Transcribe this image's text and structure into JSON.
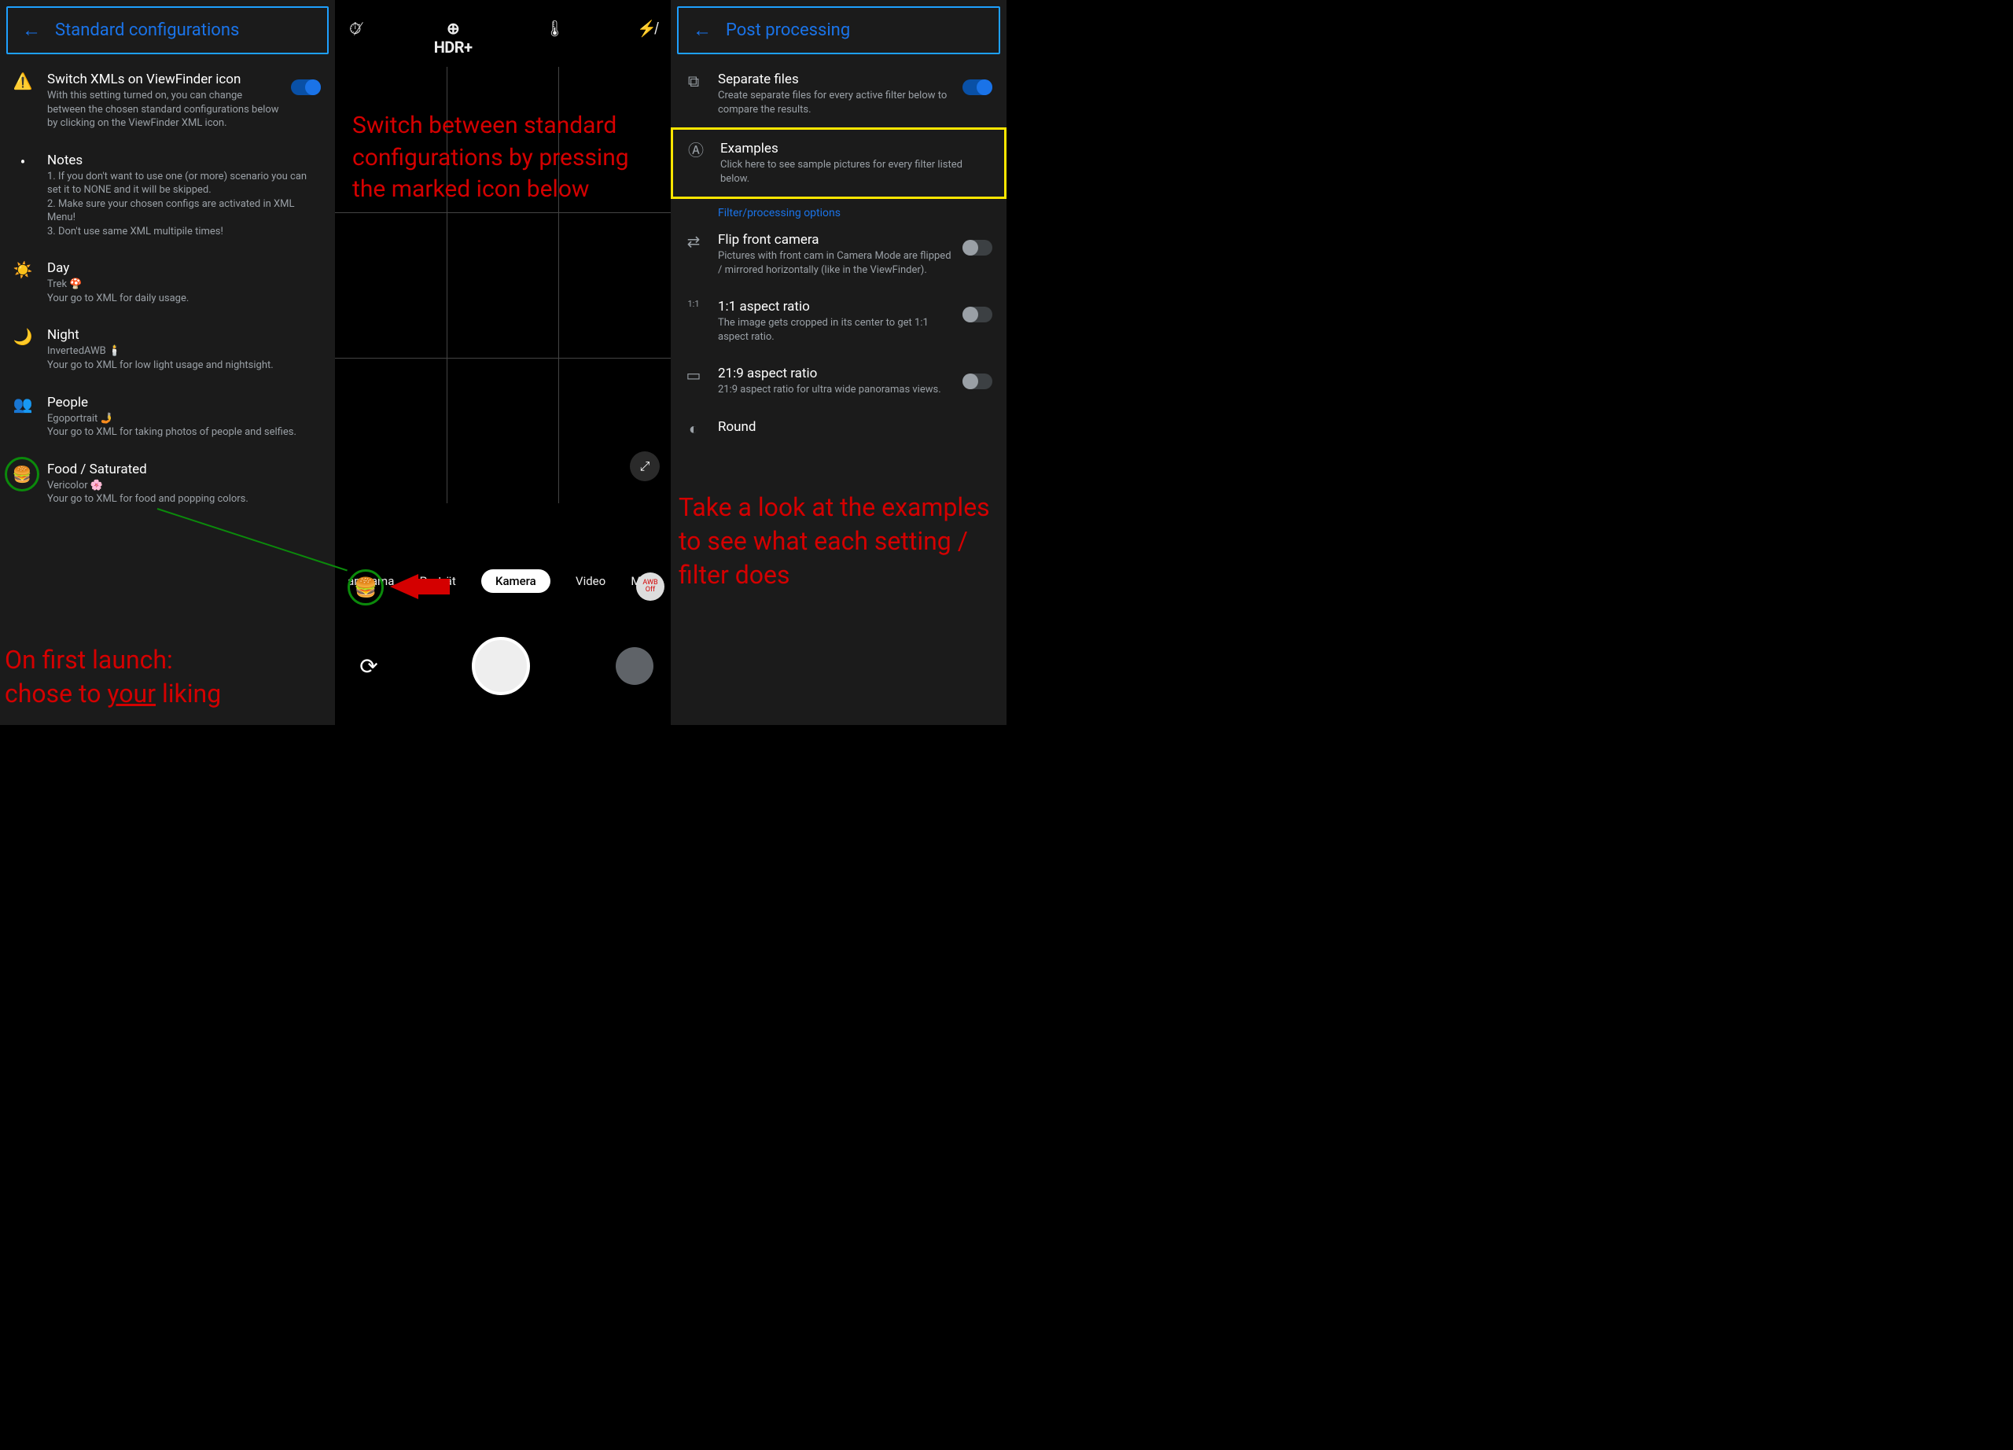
{
  "left": {
    "header_title": "Standard configurations",
    "items": [
      {
        "icon": "⚠️",
        "title": "Switch XMLs on ViewFinder icon",
        "sub": "With this setting turned on, you can change between the chosen standard configurations below by clicking on the ViewFinder XML icon.",
        "toggle": true,
        "on": true
      },
      {
        "icon": "•",
        "title": "Notes",
        "sub": "1. If you don't want to use one (or more) scenario you can set it to NONE and it will be skipped.\n2. Make sure your chosen configs are activated in XML Menu!\n3. Don't use same XML multipile times!"
      },
      {
        "icon": "☀️",
        "title": "Day",
        "sub": "Trek 🍄\nYour go to XML for daily usage."
      },
      {
        "icon": "🌙",
        "title": "Night",
        "sub": "InvertedAWB 🕯️\nYour go to XML for low light usage and nightsight."
      },
      {
        "icon": "👥",
        "title": "People",
        "sub": "Egoportrait 🤳\nYour go to XML for taking photos of people and selfies."
      },
      {
        "icon": "🍔",
        "title": "Food / Saturated",
        "sub": "Vericolor 🌸\nYour go to XML for food and popping colors.",
        "circled": true
      }
    ],
    "annotation": "On first launch:\nchose to your liking",
    "annotation_underline": "your"
  },
  "mid": {
    "top_icons": [
      "timer-off",
      "HDR+",
      "temperature",
      "flash-off"
    ],
    "hdr_label": "HDR+",
    "modes": [
      "anorama",
      "Porträt",
      "Kamera",
      "Video",
      "Mehr"
    ],
    "active_mode": "Kamera",
    "awb_badge": "AWB\nOff",
    "annotation": "Switch between standard configurations by pressing the marked icon below"
  },
  "right": {
    "header_title": "Post processing",
    "section_label": "Filter/processing options",
    "items": [
      {
        "icon": "⧉",
        "title": "Separate files",
        "sub": "Create separate files for every active filter below to compare the results.",
        "toggle": true,
        "on": true
      },
      {
        "icon": "Ⓐ",
        "title": "Examples",
        "sub": "Click here to see sample pictures for every filter listed below.",
        "boxed": true
      },
      {
        "section": true
      },
      {
        "icon": "⇄",
        "title": "Flip front camera",
        "sub": "Pictures with front cam in Camera Mode are flipped / mirrored horizontally (like in the ViewFinder).",
        "toggle": true,
        "on": false
      },
      {
        "icon": "1:1",
        "title": "1:1 aspect ratio",
        "sub": "The image gets cropped in its center to get 1:1 aspect ratio.",
        "toggle": true,
        "on": false
      },
      {
        "icon": "▭",
        "title": "21:9 aspect ratio",
        "sub": "21:9 aspect ratio for ultra wide panoramas views.",
        "toggle": true,
        "on": false
      },
      {
        "icon": "◐",
        "title": "Round",
        "sub": ""
      }
    ],
    "annotation": "Take a look at the examples to see what each setting / filter does"
  }
}
